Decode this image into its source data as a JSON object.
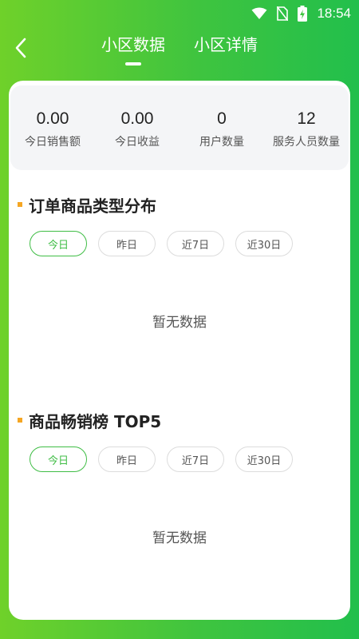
{
  "status_bar": {
    "time": "18:54",
    "icons": [
      "wifi-icon",
      "no-sim-icon",
      "battery-charging-icon"
    ]
  },
  "nav": {
    "back_icon": "chevron-left-icon",
    "tabs": [
      {
        "label": "小区数据",
        "active": true
      },
      {
        "label": "小区详情",
        "active": false
      }
    ]
  },
  "stats": [
    {
      "value": "0.00",
      "label": "今日销售额"
    },
    {
      "value": "0.00",
      "label": "今日收益"
    },
    {
      "value": "0",
      "label": "用户数量"
    },
    {
      "value": "12",
      "label": "服务人员数量"
    }
  ],
  "sections": [
    {
      "title": "订单商品类型分布",
      "filters": [
        {
          "label": "今日",
          "active": true
        },
        {
          "label": "昨日",
          "active": false
        },
        {
          "label": "近7日",
          "active": false
        },
        {
          "label": "近30日",
          "active": false
        }
      ],
      "empty_text": "暂无数据"
    },
    {
      "title": "商品畅销榜 TOP5",
      "filters": [
        {
          "label": "今日",
          "active": true
        },
        {
          "label": "昨日",
          "active": false
        },
        {
          "label": "近7日",
          "active": false
        },
        {
          "label": "近30日",
          "active": false
        }
      ],
      "empty_text": "暂无数据"
    }
  ],
  "colors": {
    "gradient_start": "#6fd12a",
    "gradient_end": "#22bf4c",
    "accent": "#3fbd45",
    "section_marker": "#f5a623"
  }
}
